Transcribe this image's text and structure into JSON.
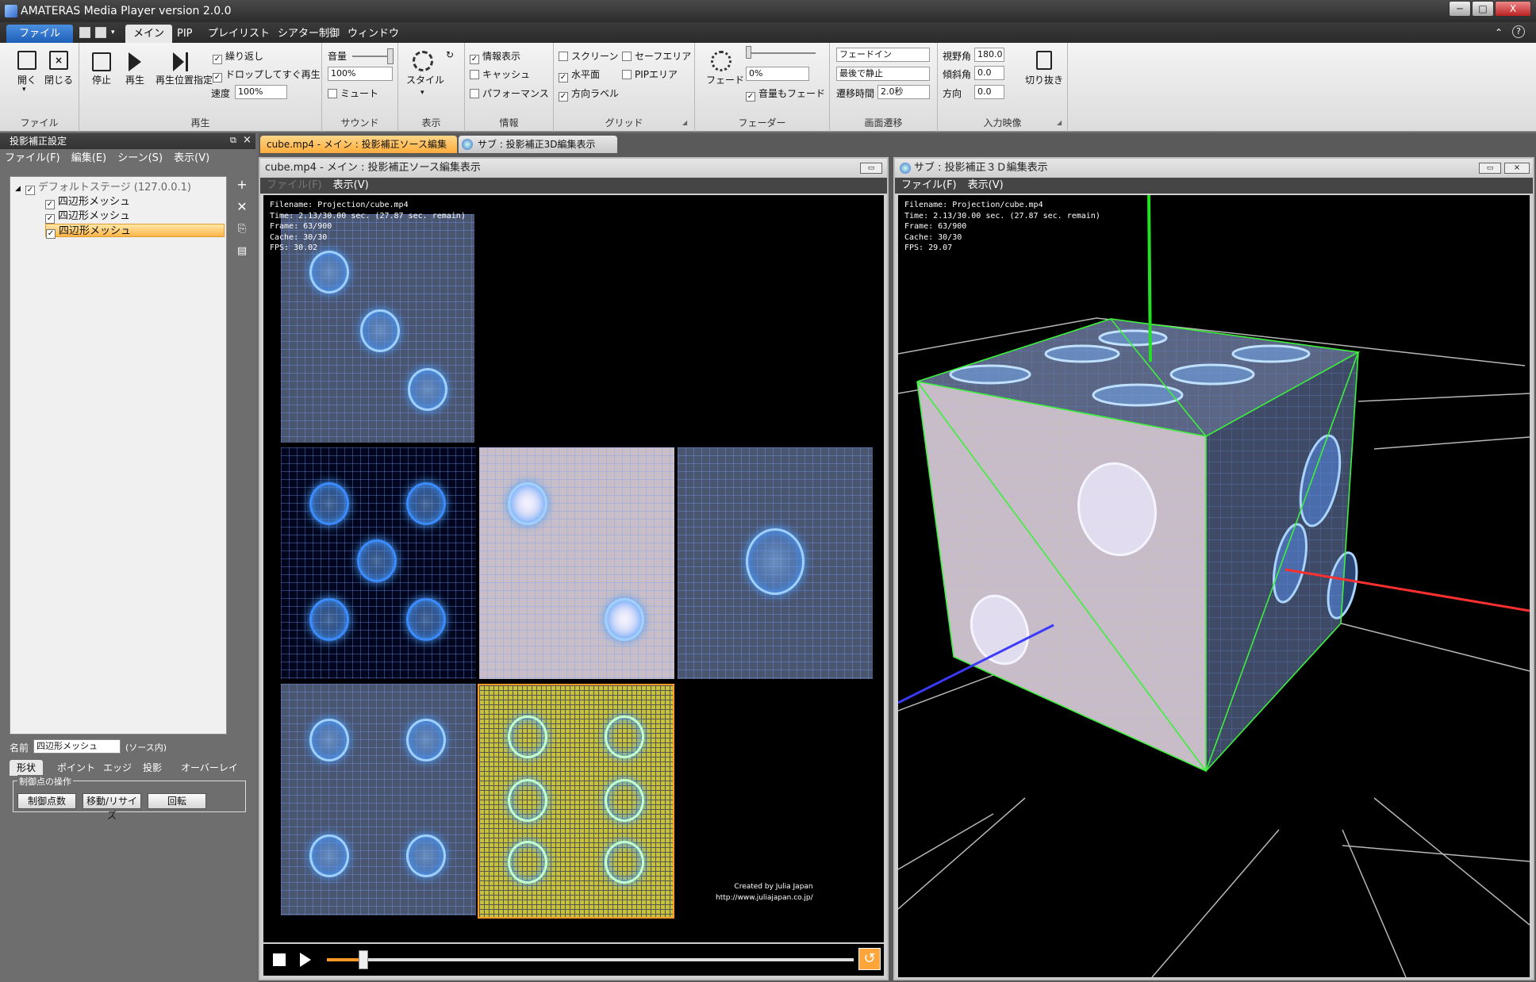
{
  "window": {
    "title": "AMATERAS Media Player version 2.0.0",
    "minimize": "─",
    "maximize": "□",
    "close": "X"
  },
  "menu_tabs": [
    "ファイル",
    "メイン",
    "PIP",
    "プレイリスト",
    "シアター制御",
    "ウィンドウ"
  ],
  "ribbon": {
    "file": {
      "open": "開く",
      "close": "閉じる",
      "label": "ファイル"
    },
    "play": {
      "stop": "停止",
      "play": "再生",
      "seek": "再生位置指定",
      "repeat": "繰り返し",
      "drop_play": "ドロップしてすぐ再生",
      "speed_label": "速度",
      "speed": "100%",
      "label": "再生"
    },
    "sound": {
      "volume_label": "音量",
      "volume": "100%",
      "mute": "ミュート",
      "label": "サウンド"
    },
    "display": {
      "style": "スタイル",
      "label": "表示"
    },
    "info": {
      "show_info": "情報表示",
      "cache": "キャッシュ",
      "performance": "パフォーマンス",
      "label": "情報"
    },
    "grid": {
      "screen": "スクリーン",
      "safe_area": "セーフエリア",
      "horizon": "水平面",
      "pip_area": "PIPエリア",
      "direction_label": "方向ラベル",
      "label": "グリッド"
    },
    "fader": {
      "fade": "フェード",
      "value": "0%",
      "fade_sound": "音量もフェード",
      "label": "フェーダー"
    },
    "transition": {
      "mode": "フェードイン",
      "end": "最後で静止",
      "time_label": "遷移時間",
      "time": "2.0秒",
      "label": "画面遷移"
    },
    "input": {
      "fov_label": "視野角",
      "fov": "180.0",
      "tilt_label": "傾斜角",
      "tilt": "0.0",
      "dir_label": "方向",
      "dir": "0.0",
      "crop": "切り抜き",
      "label": "入力映像"
    }
  },
  "left_panel": {
    "title": "投影補正設定",
    "menu": [
      "ファイル(F)",
      "編集(E)",
      "シーン(S)",
      "表示(V)"
    ],
    "tree": {
      "root": "デフォルトステージ (127.0.0.1)",
      "children": [
        "四辺形メッシュ",
        "四辺形メッシュ",
        "四辺形メッシュ"
      ]
    },
    "name_label": "名前",
    "name_value": "四辺形メッシュ",
    "name_suffix": "(ソース内)",
    "tabs": [
      "形状",
      "ポイント",
      "エッジ",
      "投影",
      "オーバーレイ"
    ],
    "control_group": "制御点の操作",
    "buttons": [
      "制御点数",
      "移動/リサイズ",
      "回転"
    ]
  },
  "doc_tabs": [
    "cube.mp4 - メイン : 投影補正ソース編集表示",
    "サブ : 投影補正3D編集表示"
  ],
  "main_pane": {
    "title": "cube.mp4 - メイン : 投影補正ソース編集表示",
    "menu": [
      "ファイル(F)",
      "表示(V)"
    ],
    "info": "Filename: Projection/cube.mp4\nTime: 2.13/30.00 sec. (27.87 sec. remain)\nFrame: 63/900\nCache: 30/30\nFPS: 30.02",
    "credit": "Created by Julia Japan\nhttp://www.juliajapan.co.jp/",
    "progress": 0.07
  },
  "sub_pane": {
    "title": "サブ : 投影補正３Ｄ編集表示",
    "menu": [
      "ファイル(F)",
      "表示(V)"
    ],
    "info": "Filename: Projection/cube.mp4\nTime: 2.13/30.00 sec. (27.87 sec. remain)\nFrame: 63/900\nCache: 30/30\nFPS: 29.07"
  }
}
